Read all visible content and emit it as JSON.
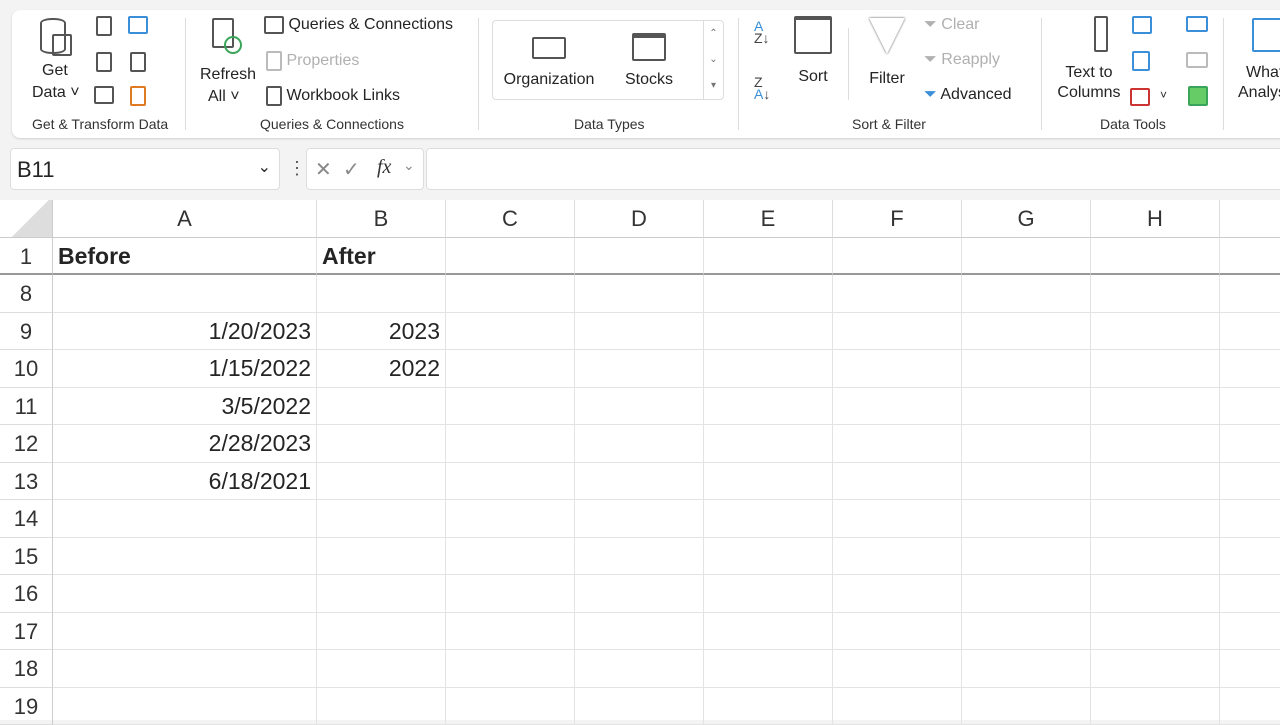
{
  "ribbon": {
    "get_data": [
      "Get",
      "Data"
    ],
    "refresh_all": [
      "Refresh",
      "All"
    ],
    "queries_connections": "Queries & Connections",
    "properties": "Properties",
    "workbook_links": "Workbook Links",
    "organization": "Organization",
    "stocks": "Stocks",
    "sort": "Sort",
    "filter": "Filter",
    "clear": "Clear",
    "reapply": "Reapply",
    "advanced": "Advanced",
    "text_to_columns": [
      "Text to",
      "Columns"
    ],
    "what_if": [
      "What-If",
      "Analysis"
    ],
    "groups": [
      "Get & Transform Data",
      "Queries & Connections",
      "Data Types",
      "Sort & Filter",
      "Data Tools"
    ]
  },
  "formula_bar": {
    "name_box": "B11",
    "fx": "fx",
    "formula": ""
  },
  "columns": [
    "A",
    "B",
    "C",
    "D",
    "E",
    "F",
    "G",
    "H"
  ],
  "rows": [
    {
      "num": "1",
      "a": "Before",
      "b": "After",
      "header": true
    },
    {
      "num": "8",
      "a": "",
      "b": ""
    },
    {
      "num": "9",
      "a": "1/20/2023",
      "b": "2023"
    },
    {
      "num": "10",
      "a": "1/15/2022",
      "b": "2022"
    },
    {
      "num": "11",
      "a": "3/5/2022",
      "b": ""
    },
    {
      "num": "12",
      "a": "2/28/2023",
      "b": ""
    },
    {
      "num": "13",
      "a": "6/18/2021",
      "b": ""
    },
    {
      "num": "14",
      "a": "",
      "b": ""
    },
    {
      "num": "15",
      "a": "",
      "b": ""
    },
    {
      "num": "16",
      "a": "",
      "b": ""
    },
    {
      "num": "17",
      "a": "",
      "b": ""
    },
    {
      "num": "18",
      "a": "",
      "b": ""
    },
    {
      "num": "19",
      "a": "",
      "b": ""
    }
  ]
}
